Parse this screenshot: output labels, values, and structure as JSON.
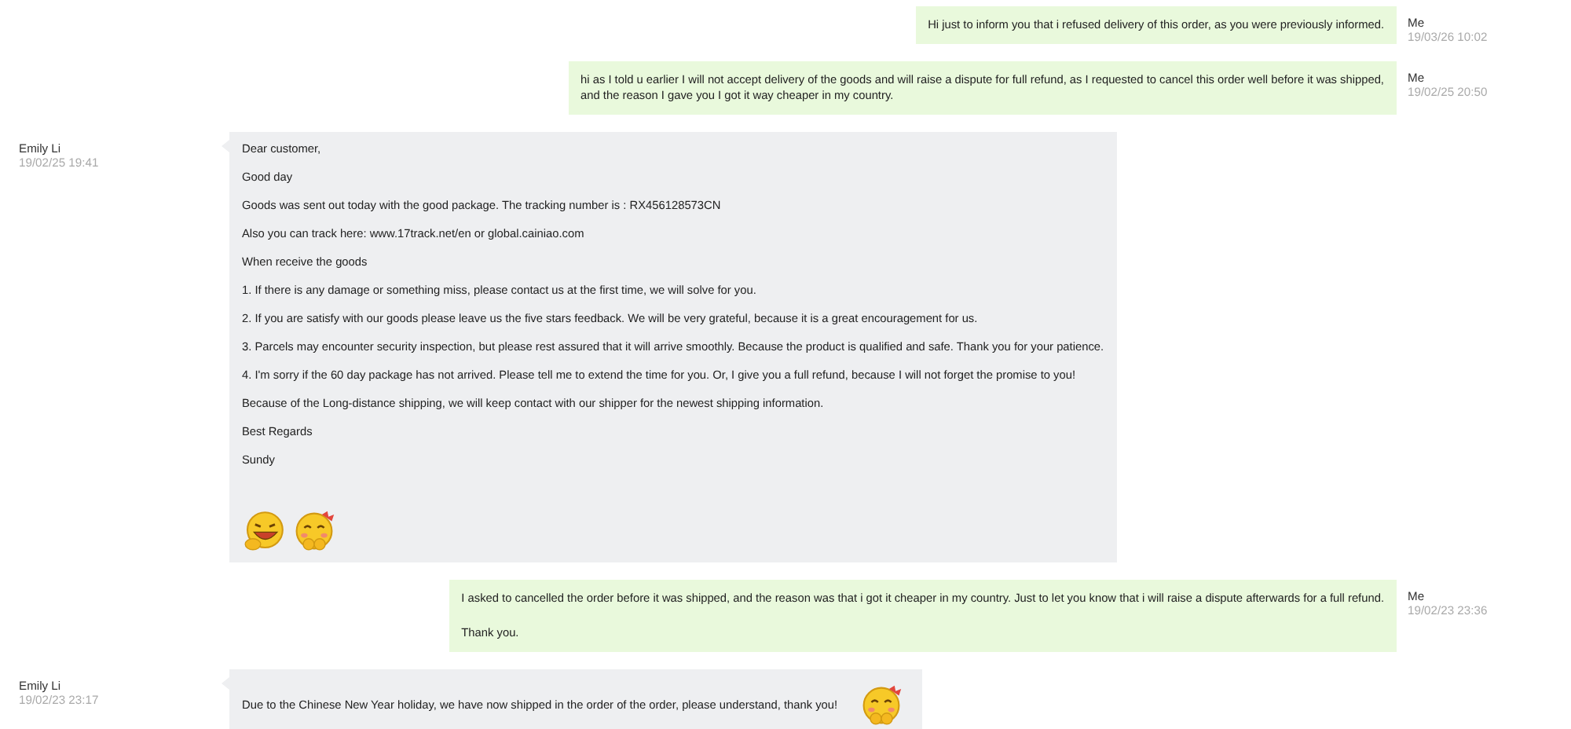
{
  "messages": [
    {
      "kind": "sent",
      "sender": "Me",
      "time": "19/03/26 10:02",
      "paragraphs": [
        "Hi just to inform you that i refused delivery of this order, as you were previously informed."
      ]
    },
    {
      "kind": "sent",
      "sender": "Me",
      "time": "19/02/25 20:50",
      "paragraphs": [
        "hi as I told u earlier I will not accept delivery of the goods and will raise a dispute for full refund, as I requested to cancel this order well before it was shipped,\nand the reason I gave you I got it way cheaper in my country."
      ]
    },
    {
      "kind": "received",
      "sender": "Emily Li",
      "time": "19/02/25 19:41",
      "paragraphs": [
        "Dear customer,",
        "Good day",
        "Goods was sent out today with the good package. The tracking number is : RX456128573CN",
        "Also you can track here: www.17track.net/en or global.cainiao.com",
        "When receive the goods",
        "1. If there is any damage or something miss, please contact us at the first time, we will solve for you.",
        "2. If you are satisfy with our goods please leave us the five stars feedback. We will be very grateful, because it is a great encouragement for us.",
        "3. Parcels may encounter security inspection, but please rest assured that it will arrive smoothly. Because the product is qualified and safe. Thank you for your patience.",
        "4. I'm sorry if the 60 day package has not arrived. Please tell me to extend the time for you. Or, I give you a full refund, because I will not forget the promise to you!",
        "Because of the Long-distance shipping, we will keep contact with our shipper for the newest shipping information.",
        "Best Regards",
        "Sundy"
      ],
      "emojis": [
        {
          "kind": "laughing"
        },
        {
          "kind": "blushing"
        }
      ]
    },
    {
      "kind": "sent",
      "sender": "Me",
      "time": "19/02/23 23:36",
      "paragraphs": [
        "I asked to cancelled the order before it was shipped, and the reason was that i got it cheaper in my country. Just to let you know that i will raise a dispute afterwards for a full refund.",
        "Thank you."
      ]
    },
    {
      "kind": "received",
      "sender": "Emily Li",
      "time": "19/02/23 23:17",
      "paragraphs": [
        "Due to the Chinese New Year holiday, we have now shipped in the order of the order, please understand, thank you!"
      ],
      "emojis": [
        {
          "kind": "blushing"
        }
      ]
    }
  ]
}
